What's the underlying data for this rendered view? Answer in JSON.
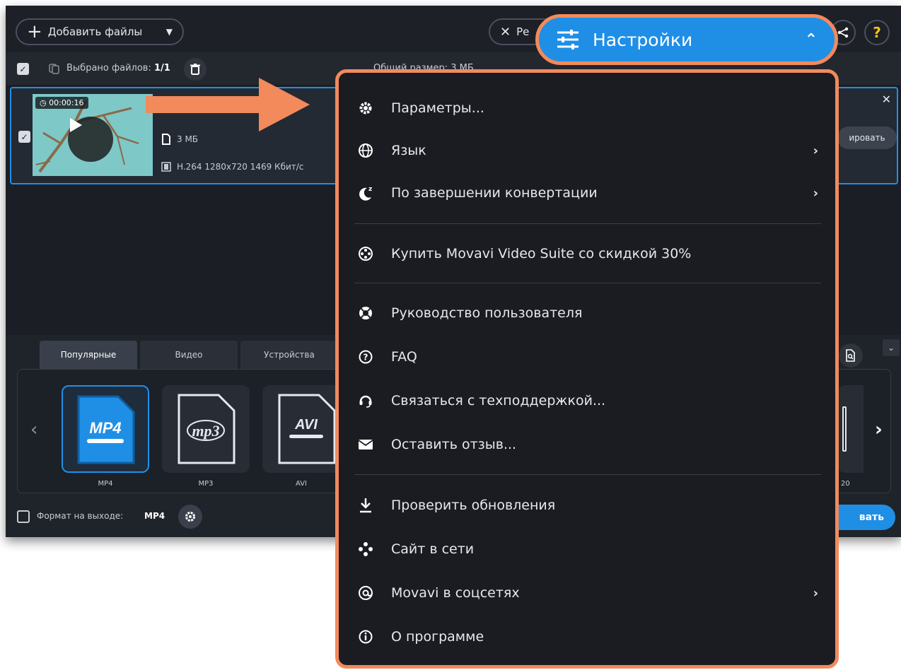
{
  "toolbar": {
    "add_files_label": "Добавить файлы",
    "tools_label": "Ре"
  },
  "selection": {
    "selected_label": "Выбрано файлов:",
    "selected_value": "1/1",
    "total_size_label": "Общий размер: 3 МБ"
  },
  "file": {
    "duration": "00:00:16",
    "size": "3 МБ",
    "codec": "H.264 1280x720 1469 Кбит/с",
    "convert_label": "ировать"
  },
  "formats": {
    "tabs": [
      "Популярные",
      "Видео",
      "Устройства"
    ],
    "active_tab": 0,
    "items": [
      {
        "label": "MP4",
        "selected": true
      },
      {
        "label": "MP3",
        "selected": false
      },
      {
        "label": "AVI",
        "selected": false
      }
    ],
    "peek_label": "20",
    "output_label": "Формат на выходе:",
    "output_value": "MP4",
    "convert_label": "вать"
  },
  "settings_button": {
    "label": "Настройки"
  },
  "menu": {
    "items": [
      {
        "label": "Параметры...",
        "icon": "gear-icon",
        "submenu": false
      },
      {
        "label": "Язык",
        "icon": "globe-icon",
        "submenu": true
      },
      {
        "label": "По завершении конвертации",
        "icon": "sleep-moon-icon",
        "submenu": true
      },
      {
        "label": "Купить Movavi Video Suite со скидкой 30%",
        "icon": "film-reel-icon",
        "submenu": false
      },
      {
        "label": "Руководство пользователя",
        "icon": "lifebuoy-icon",
        "submenu": false
      },
      {
        "label": "FAQ",
        "icon": "question-circle-icon",
        "submenu": false
      },
      {
        "label": "Связаться с техподдержкой...",
        "icon": "headset-icon",
        "submenu": false
      },
      {
        "label": "Оставить отзыв...",
        "icon": "envelope-icon",
        "submenu": false
      },
      {
        "label": "Проверить обновления",
        "icon": "download-icon",
        "submenu": false
      },
      {
        "label": "Сайт в сети",
        "icon": "network-icon",
        "submenu": false
      },
      {
        "label": "Movavi в соцсетях",
        "icon": "at-sign-icon",
        "submenu": true
      },
      {
        "label": "О программе",
        "icon": "info-circle-icon",
        "submenu": false
      }
    ]
  },
  "colors": {
    "accent": "#1f8fe6",
    "highlight": "#f28a5c",
    "menu_bg": "#1a1c21",
    "app_bg": "#1b1e24"
  }
}
